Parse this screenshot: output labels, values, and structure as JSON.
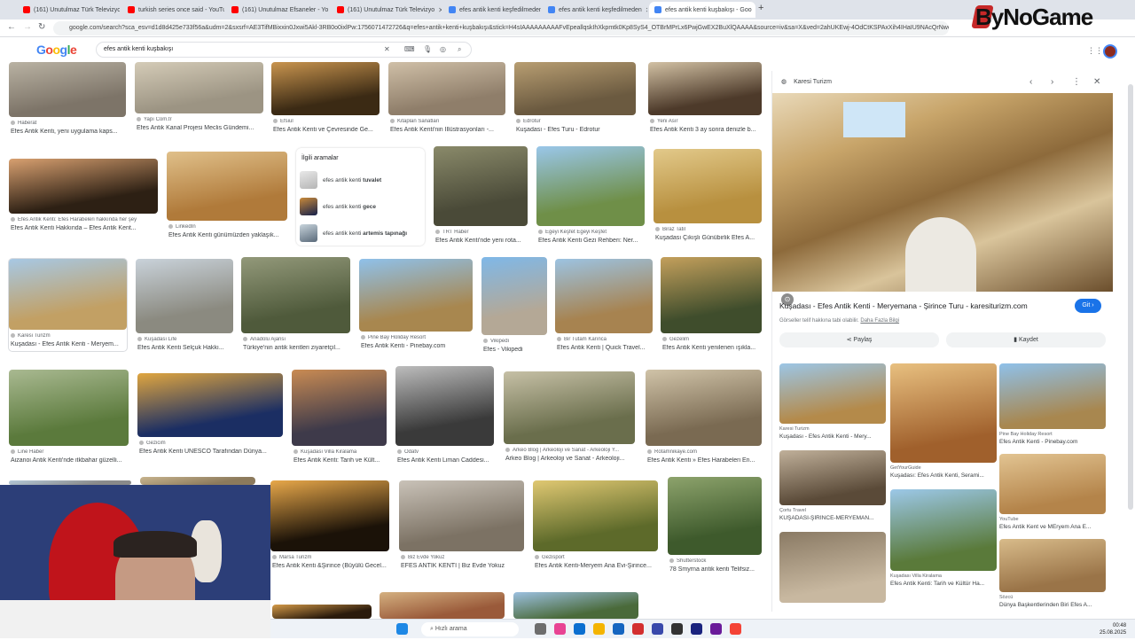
{
  "browser": {
    "tabs": [
      {
        "label": "(161) Unutulmaz Türk Televizyo",
        "color": "#ff0000"
      },
      {
        "label": "turkish series once said - YouTu",
        "color": "#ff0000"
      },
      {
        "label": "(161) Unutulmaz Efsaneler - Yo",
        "color": "#ff0000"
      },
      {
        "label": "(161) Unutulmaz Türk Televizyo",
        "color": "#ff0000"
      },
      {
        "label": "efes antik kenti keşfedilmeden",
        "color": "#4285f4"
      },
      {
        "label": "efes antik kenti keşfedilmeden",
        "color": "#4285f4"
      },
      {
        "label": "efes antik kenti kuşbakışı - Goo",
        "color": "#4285f4"
      }
    ],
    "url": "google.com/search?sca_esv=d1d8d425e733f56a&udm=2&sxsrf=AE3TifMBixxin0Jxwi5Akl-3RB0o0ixlPw:1756071472726&q=efes+antik+kenti+kuşbakışı&stick=H4sIAAAAAAAAAFvEpeallqskIhXkpmtk0Kp8SyS4_OTBrMPrLx6PwjGwEX2BuXlQAAAA&source=iv&sa=X&ved=2ahUKEwj-4OdCtKSPAxXih4IHaIU9NAcQrNwCegQIVxAA&biw=2560&bih=1271&dpr=1"
  },
  "brand": "ByNoGame",
  "google": {
    "logo": [
      "G",
      "o",
      "o",
      "g",
      "l",
      "e"
    ],
    "query": "efes antik kenti kuşbakışı"
  },
  "results": [
    {
      "src": "Haberat",
      "title": "Efes Antik Kenti, yeni uygulama kaps...",
      "c1": "#7d7468",
      "c2": "#b9b2a3"
    },
    {
      "src": "Yapı Com.tr",
      "title": "Efes Antik Kanal Projesi Meclis Gündemi...",
      "c1": "#9c9483",
      "c2": "#d4cbb7"
    },
    {
      "src": "Efsiul",
      "title": "Efes Antik Kenti ve Çevresinde Ge...",
      "c1": "#3b2a14",
      "c2": "#c9954f"
    },
    {
      "src": "Kitaplan Sanatları",
      "title": "Efes Antik Kenti'nin İllüstrasyonları -...",
      "c1": "#8f7e6a",
      "c2": "#cfbfa7"
    },
    {
      "src": "Edrotur",
      "title": "Kuşadası - Efes Turu - Edrotur",
      "c1": "#6b5a40",
      "c2": "#b89e72"
    },
    {
      "src": "Yeni Asır",
      "title": "Efes Antik Kenti 3 ay sonra denizle b...",
      "c1": "#4d3a2a",
      "c2": "#d2c1a4"
    },
    {
      "src": "Efes Antik Kenti: Efes Harabeleri hakkında her şey",
      "title": "Efes Antik Kenti Hakkında – Efes Antik Kent...",
      "c1": "#2d2014",
      "c2": "#d8a070"
    },
    {
      "src": "LinkedIn",
      "title": "Efes Antik Kenti günümüzden yaklaşık...",
      "c1": "#b07a3a",
      "c2": "#e0c08a"
    },
    {
      "src": "TRT Haber",
      "title": "Efes Antik Kenti'nde yeni rota...",
      "c1": "#4a4a38",
      "c2": "#8a8a6a"
    },
    {
      "src": "Egeyi Keşfet Egeyi Keşfet",
      "title": "Efes Antik Kenti Gezi Rehberi: Ner...",
      "c1": "#6f8f48",
      "c2": "#9ac7ea"
    },
    {
      "src": "Biraz Tatil",
      "title": "Kuşadası Çıkışlı Günübirlik Efes A...",
      "c1": "#b8903f",
      "c2": "#e2c98a"
    },
    {
      "src": "Karesi Turizm",
      "title": "Kuşadası - Efes Antik Kenti - Meryem...",
      "c1": "#c2a064",
      "c2": "#a7c8e4"
    },
    {
      "src": "Kuşadası Life",
      "title": "Efes Antik Kenti Selçuk Hakkı...",
      "c1": "#8b8a80",
      "c2": "#c9d2da"
    },
    {
      "src": "Anadolu Ajansı",
      "title": "Türkiye'nin antik kentleri ziyaretçil...",
      "c1": "#4f5a3b",
      "c2": "#93997a"
    },
    {
      "src": "Pine Bay Holiday Resort",
      "title": "Efes Antik Kenti - Pinebay.com",
      "c1": "#a8874f",
      "c2": "#8fc1ea"
    },
    {
      "src": "Vikipedi",
      "title": "Efes - Vikipedi",
      "c1": "#b4a896",
      "c2": "#7fb8e8"
    },
    {
      "src": "Bir Tutam Karınca",
      "title": "Efes Antik Kenti | Quick Travel...",
      "c1": "#a78350",
      "c2": "#9cc3e2"
    },
    {
      "src": "Gezelim",
      "title": "Efes Antik Kenti yenilenen ışıkla...",
      "c1": "#3f4d2c",
      "c2": "#c4a05c"
    },
    {
      "src": "Line Haber",
      "title": "Aizanoi Antik Kenti'nde itkbahar güzelli...",
      "c1": "#5b7a3c",
      "c2": "#a9b991"
    },
    {
      "src": "Gezicim",
      "title": "Efes Antik Kenti UNESCO Tarafından Dünya...",
      "c1": "#1b2e63",
      "c2": "#e0a640"
    },
    {
      "src": "Kuşadası Villa Kiralama",
      "title": "Efes Antik Kenti: Tarih ve Kült...",
      "c1": "#3e3a4a",
      "c2": "#c98b53"
    },
    {
      "src": "Odatv",
      "title": "Efes Antik Kenti Liman Caddesi...",
      "c1": "#3a3a3a",
      "c2": "#bdbdbd"
    },
    {
      "src": "Arkeo Blog | Arkeoloji ve Sanat - Arkeoloji Y...",
      "title": "Arkeo Blog | Arkeoloji ve Sanat - Arkeoloji...",
      "c1": "#6a6e4c",
      "c2": "#c6c0a6"
    },
    {
      "src": "Rotamnikaye.com",
      "title": "Efes Antik Kenti » Efes Harabeleri En...",
      "c1": "#7a6a52",
      "c2": "#d0c3a8"
    },
    {
      "src": "",
      "title": "",
      "c1": "#8a8a8a",
      "c2": "#b5c9d9"
    },
    {
      "src": "",
      "title": "",
      "c1": "#8c7a5c",
      "c2": "#c8b48e"
    },
    {
      "src": "Marsa Turizm",
      "title": "Efes Antik Kenti &Şirince (Büyülü Gecel...",
      "c1": "#1b1208",
      "c2": "#e8a84a"
    },
    {
      "src": "Biz Evde Yokuz",
      "title": "EFES ANTİK KENTİ | Biz Evde Yokuz",
      "c1": "#7c7264",
      "c2": "#c9c2b8"
    },
    {
      "src": "Gezisport",
      "title": "Efes Antik Kenti-Meryem Ana Evi-Şirince...",
      "c1": "#5d6a2a",
      "c2": "#e0c872"
    },
    {
      "src": "Shutterstock",
      "title": "78 Smyrna antik kenti Telifsiz...",
      "c1": "#3e5a2c",
      "c2": "#8da36c"
    },
    {
      "src": "",
      "title": "",
      "c1": "#2a1a0c",
      "c2": "#d49a48"
    },
    {
      "src": "",
      "title": "",
      "c1": "#9a5a3a",
      "c2": "#d4b080"
    },
    {
      "src": "",
      "title": "",
      "c1": "#4a6a3a",
      "c2": "#9cc0e0"
    }
  ],
  "related": {
    "heading": "İlgili aramalar",
    "items": [
      {
        "base": "efes antik kenti",
        "bold": "tuvalet",
        "c1": "#b5b5b5",
        "c2": "#e8e8e8"
      },
      {
        "base": "efes antik kenti",
        "bold": "gece",
        "c1": "#15204a",
        "c2": "#c98a3a"
      },
      {
        "base": "efes antik kenti",
        "bold": "artemis tapınağı",
        "c1": "#5a6a7a",
        "c2": "#c8d4dc"
      }
    ]
  },
  "panel": {
    "source": "Karesi Turizm",
    "title": "Kuşadası - Efes Antik Kenti - Meryemana - Şirince Turu - karesiturizm.com",
    "note": "Görseller telif hakkına tabi olabilir.",
    "note_link": "Daha Fazla Bilgi",
    "go_label": "Git",
    "share_label": "Paylaş",
    "save_label": "Kaydet",
    "related": [
      {
        "src": "Karesi Turizm",
        "title": "Kuşadası - Efes Antik Kenti - Mery...",
        "c1": "#b48a4a",
        "c2": "#9cc6e6"
      },
      {
        "src": "GetYourGuide",
        "title": "Kuşadası: Efes Antik Kenti, Serami...",
        "c1": "#a0602c",
        "c2": "#e8c080"
      },
      {
        "src": "Pine Bay Holiday Resort",
        "title": "Efes Antik Kenti - Pinebay.com",
        "c1": "#a8874f",
        "c2": "#8fc1ea"
      },
      {
        "src": "Çortu Travel",
        "title": "KUŞADASI-ŞİRİNCE-MERYEMAN...",
        "c1": "#5a4a38",
        "c2": "#c0b09a"
      },
      {
        "src": "Kuşadası Villa Kiralama",
        "title": "Efes Antik Kenti: Tarih ve Kültür Ha...",
        "c1": "#5a7a3a",
        "c2": "#9cc8e8"
      },
      {
        "src": "YouTube",
        "title": "Efes Antik Kent ve MEryem Ana E...",
        "c1": "#b4844a",
        "c2": "#e2c492"
      },
      {
        "src": "",
        "title": "",
        "c1": "#c8b8a0",
        "c2": "#8a7a64"
      },
      {
        "src": "Sözcü",
        "title": "Dünya Başkentlerinden Biri Efes A...",
        "c1": "#9a7448",
        "c2": "#d8bb8a"
      }
    ]
  },
  "taskbar": {
    "search_label": "Hızlı arama",
    "time": "00:48",
    "date": "25.08.2025"
  }
}
